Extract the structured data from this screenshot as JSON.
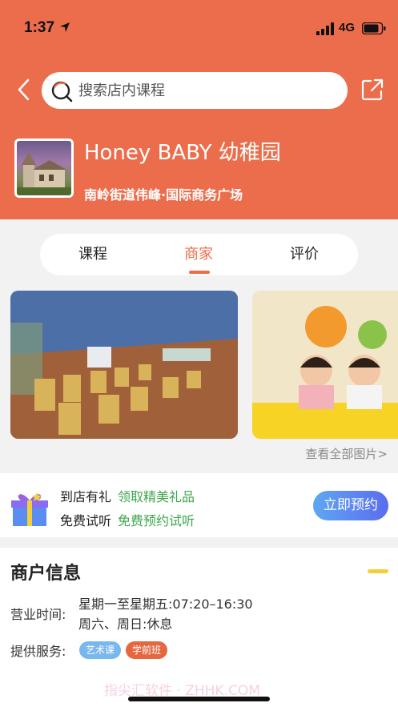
{
  "status": {
    "time": "1:37",
    "network": "4G"
  },
  "search": {
    "placeholder": "搜索店内课程"
  },
  "shop": {
    "name": "Honey BABY 幼稚园",
    "address": "南岭街道伟峰·国际商务广场"
  },
  "tabs": [
    {
      "label": "课程",
      "active": false
    },
    {
      "label": "商家",
      "active": true
    },
    {
      "label": "评价",
      "active": false
    }
  ],
  "gallery": {
    "view_all": "查看全部图片>"
  },
  "promo": {
    "rows": [
      {
        "key": "到店有礼",
        "value": "领取精美礼品"
      },
      {
        "key": "免费试听",
        "value": "免费预约试听"
      }
    ],
    "book_label": "立即预约"
  },
  "info": {
    "title": "商户信息",
    "hours_label": "营业时间:",
    "hours": [
      "星期一至星期五:07:20–16:30",
      "周六、周日:休息"
    ],
    "services_label": "提供服务:",
    "services": [
      "艺术课",
      "学前班"
    ],
    "watermark": "指尖汇软件 · ZHHK.COM"
  },
  "colors": {
    "brand": "#ec6d4b",
    "green": "#3ca64a",
    "blue": "#5b6cf0"
  }
}
